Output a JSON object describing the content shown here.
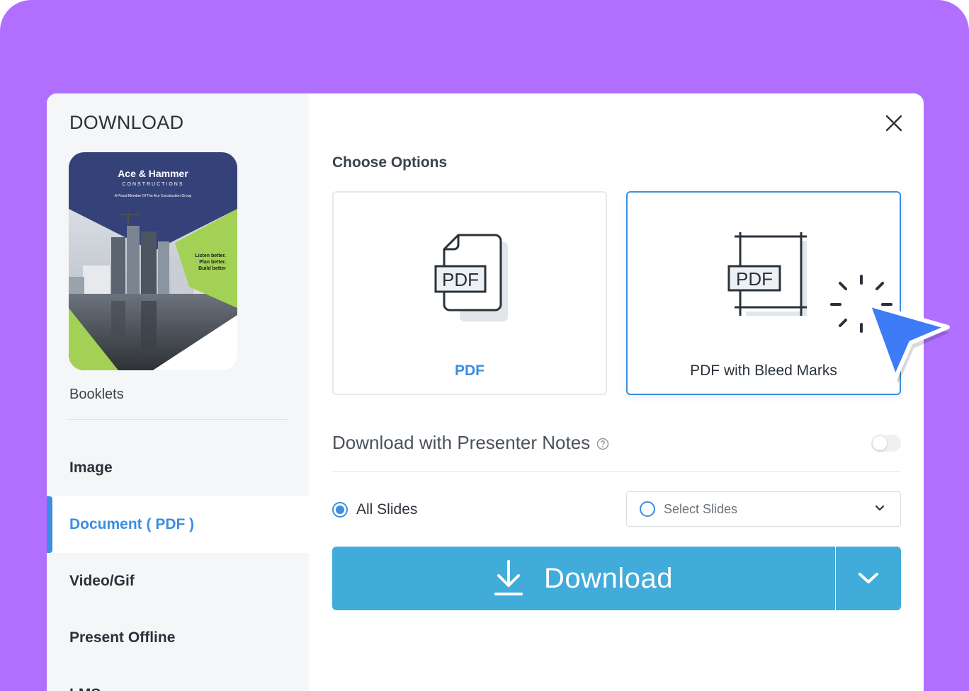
{
  "sidebar": {
    "title": "DOWNLOAD",
    "preview": {
      "brand": "Ace & Hammer",
      "brand_sub": "CONSTRUCTIONS",
      "tagline": "A Proud Member Of The Ace Construction Group",
      "slogan": [
        "Listen better.",
        "Plan better.",
        "Build better"
      ]
    },
    "category": "Booklets",
    "nav": [
      {
        "label": "Image",
        "active": false
      },
      {
        "label": "Document ( PDF )",
        "active": true
      },
      {
        "label": "Video/Gif",
        "active": false
      },
      {
        "label": "Present Offline",
        "active": false
      },
      {
        "label": "LMS",
        "active": false
      }
    ]
  },
  "main": {
    "section_title": "Choose Options",
    "options": [
      {
        "label": "PDF",
        "icon": "pdf-file-icon",
        "selected": false
      },
      {
        "label": "PDF with Bleed Marks",
        "icon": "pdf-bleed-marks-icon",
        "selected": true
      }
    ],
    "icon_text": "PDF",
    "presenter_notes": {
      "label": "Download with Presenter Notes",
      "enabled": false
    },
    "slides": {
      "all_label": "All Slides",
      "select_placeholder": "Select Slides"
    },
    "download": {
      "label": "Download"
    }
  },
  "colors": {
    "background": "#b06fff",
    "accent": "#3b8ee0",
    "button": "#41acd9",
    "cursor": "#3d7bf7"
  }
}
